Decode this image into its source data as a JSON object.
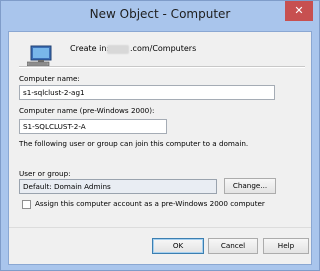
{
  "window": {
    "title": "New Object - Computer",
    "close_glyph": "✕"
  },
  "header": {
    "create_in_label": "Create in:",
    "path": ".com/Computers",
    "icon": "computer-icon"
  },
  "form": {
    "computer_name_label": "Computer name:",
    "computer_name_value": "s1-sqlclust-2-ag1",
    "pre2000_label": "Computer name (pre-Windows 2000):",
    "pre2000_value": "S1-SQLCLUST-2-A",
    "info_text": "The following user or group can join this computer to a domain.",
    "user_group_label": "User or group:",
    "user_group_value": "Default: Domain Admins",
    "change_button": "Change...",
    "assign_checkbox_label": "Assign this computer account as a pre-Windows 2000 computer",
    "assign_checked": false
  },
  "buttons": {
    "ok": "OK",
    "cancel": "Cancel",
    "help": "Help"
  }
}
